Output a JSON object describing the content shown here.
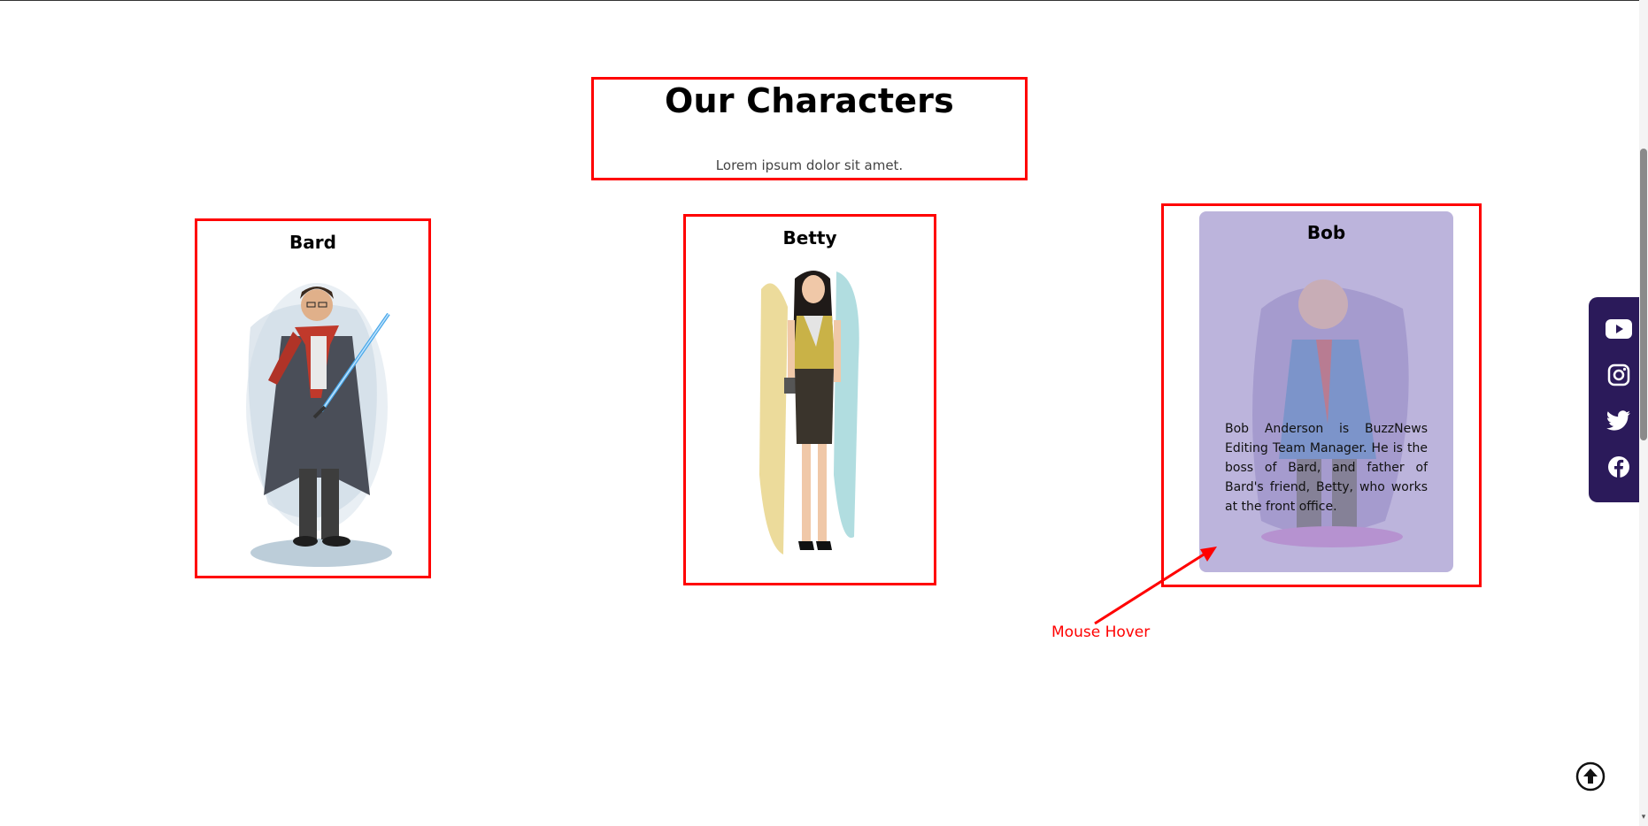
{
  "section": {
    "title": "Our Characters",
    "subtitle": "Lorem ipsum dolor sit amet."
  },
  "characters": [
    {
      "name": "Bard"
    },
    {
      "name": "Betty"
    },
    {
      "name": "Bob",
      "description": "Bob Anderson is BuzzNews Editing Team Manager. He is the boss of Bard, and father of Bard's friend, Betty, who works at the front office."
    }
  ],
  "annotation": {
    "label": "Mouse Hover"
  },
  "social": {
    "icons": [
      "youtube-icon",
      "instagram-icon",
      "twitter-icon",
      "facebook-icon"
    ]
  },
  "colors": {
    "highlight_border": "#ff0000",
    "hover_overlay": "#bcb4dc",
    "social_bar_bg": "#2b1a5a"
  }
}
